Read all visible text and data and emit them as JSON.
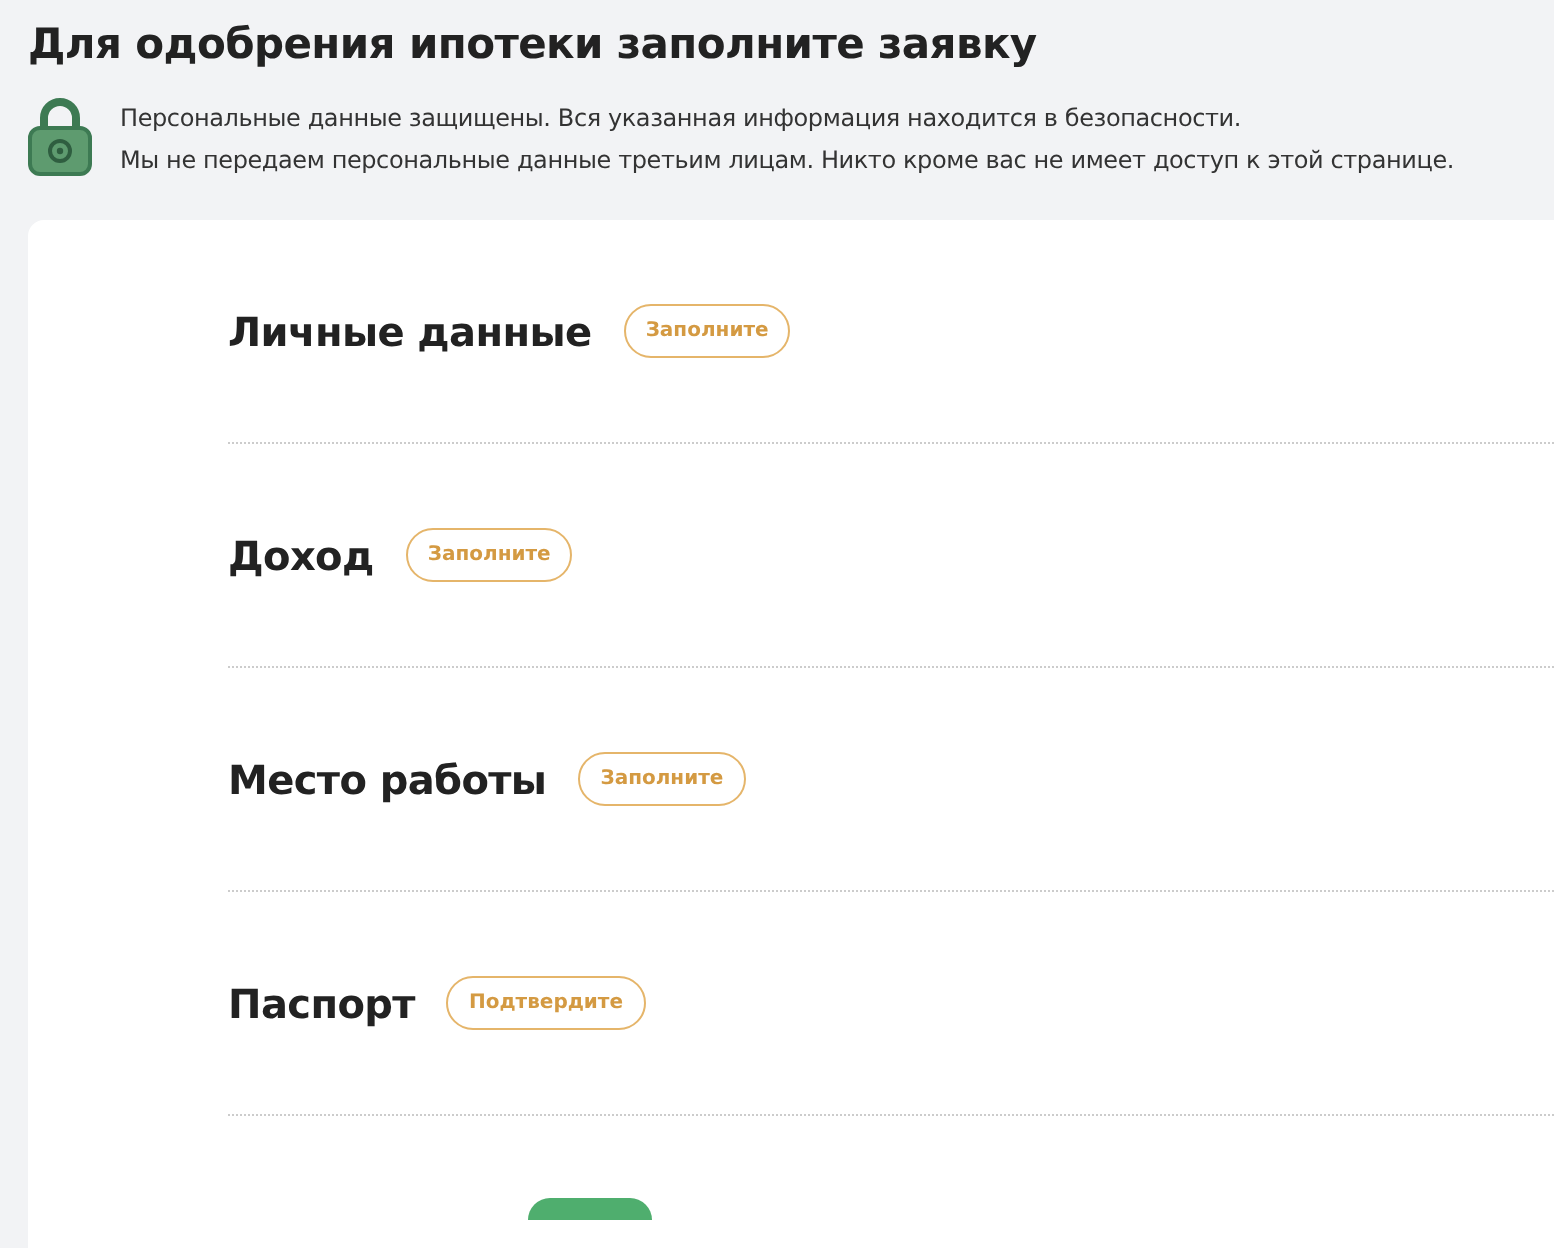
{
  "title": "Для одобрения ипотеки заполните заявку",
  "notice": [
    "Персональные данные защищены. Вся указанная информация находится в безопасности.",
    "Мы не передаем персональные данные третьим лицам. Никто кроме вас не имеет доступ к этой странице."
  ],
  "sections": [
    {
      "title": "Личные данные",
      "status": {
        "kind": "pending",
        "label": "Заполните"
      }
    },
    {
      "title": "Доход",
      "status": {
        "kind": "pending",
        "label": "Заполните"
      }
    },
    {
      "title": "Место работы",
      "status": {
        "kind": "pending",
        "label": "Заполните"
      }
    },
    {
      "title": "Паспорт",
      "status": {
        "kind": "pending",
        "label": "Подтвердите"
      }
    },
    {
      "status": {
        "kind": "done"
      }
    }
  ]
}
